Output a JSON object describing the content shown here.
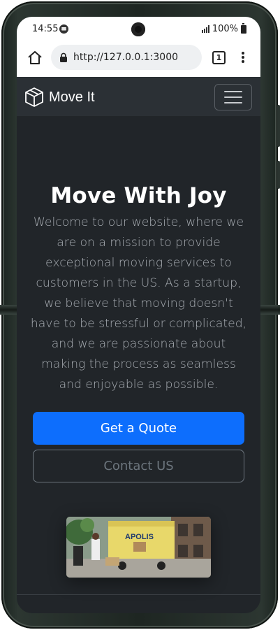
{
  "status_bar": {
    "time": "14:55",
    "battery": "100%",
    "icons": [
      "spotify-icon",
      "signal-icon",
      "battery-icon"
    ]
  },
  "browser": {
    "url": "http://127.0.0.1:3000",
    "tab_count": "1",
    "icons": [
      "home-icon",
      "lock-icon",
      "tabs-icon",
      "overflow-menu-icon"
    ]
  },
  "navbar": {
    "brand": "Move It",
    "icons": [
      "box-icon",
      "hamburger-icon"
    ]
  },
  "hero": {
    "title": "Move With Joy",
    "description": "Welcome to our website, where we are on a mission to provide exceptional moving services to customers in the US. As a startup, we believe that moving doesn't have to be stressful or complicated, and we are passionate about making the process as seamless and enjoyable as possible.",
    "primary_button": "Get a Quote",
    "secondary_button": "Contact US"
  },
  "image": {
    "truck_text": "APOLIS"
  },
  "colors": {
    "background": "#212529",
    "navbar": "#2b3035",
    "primary": "#0d6efd",
    "outline": "#6c757d"
  }
}
